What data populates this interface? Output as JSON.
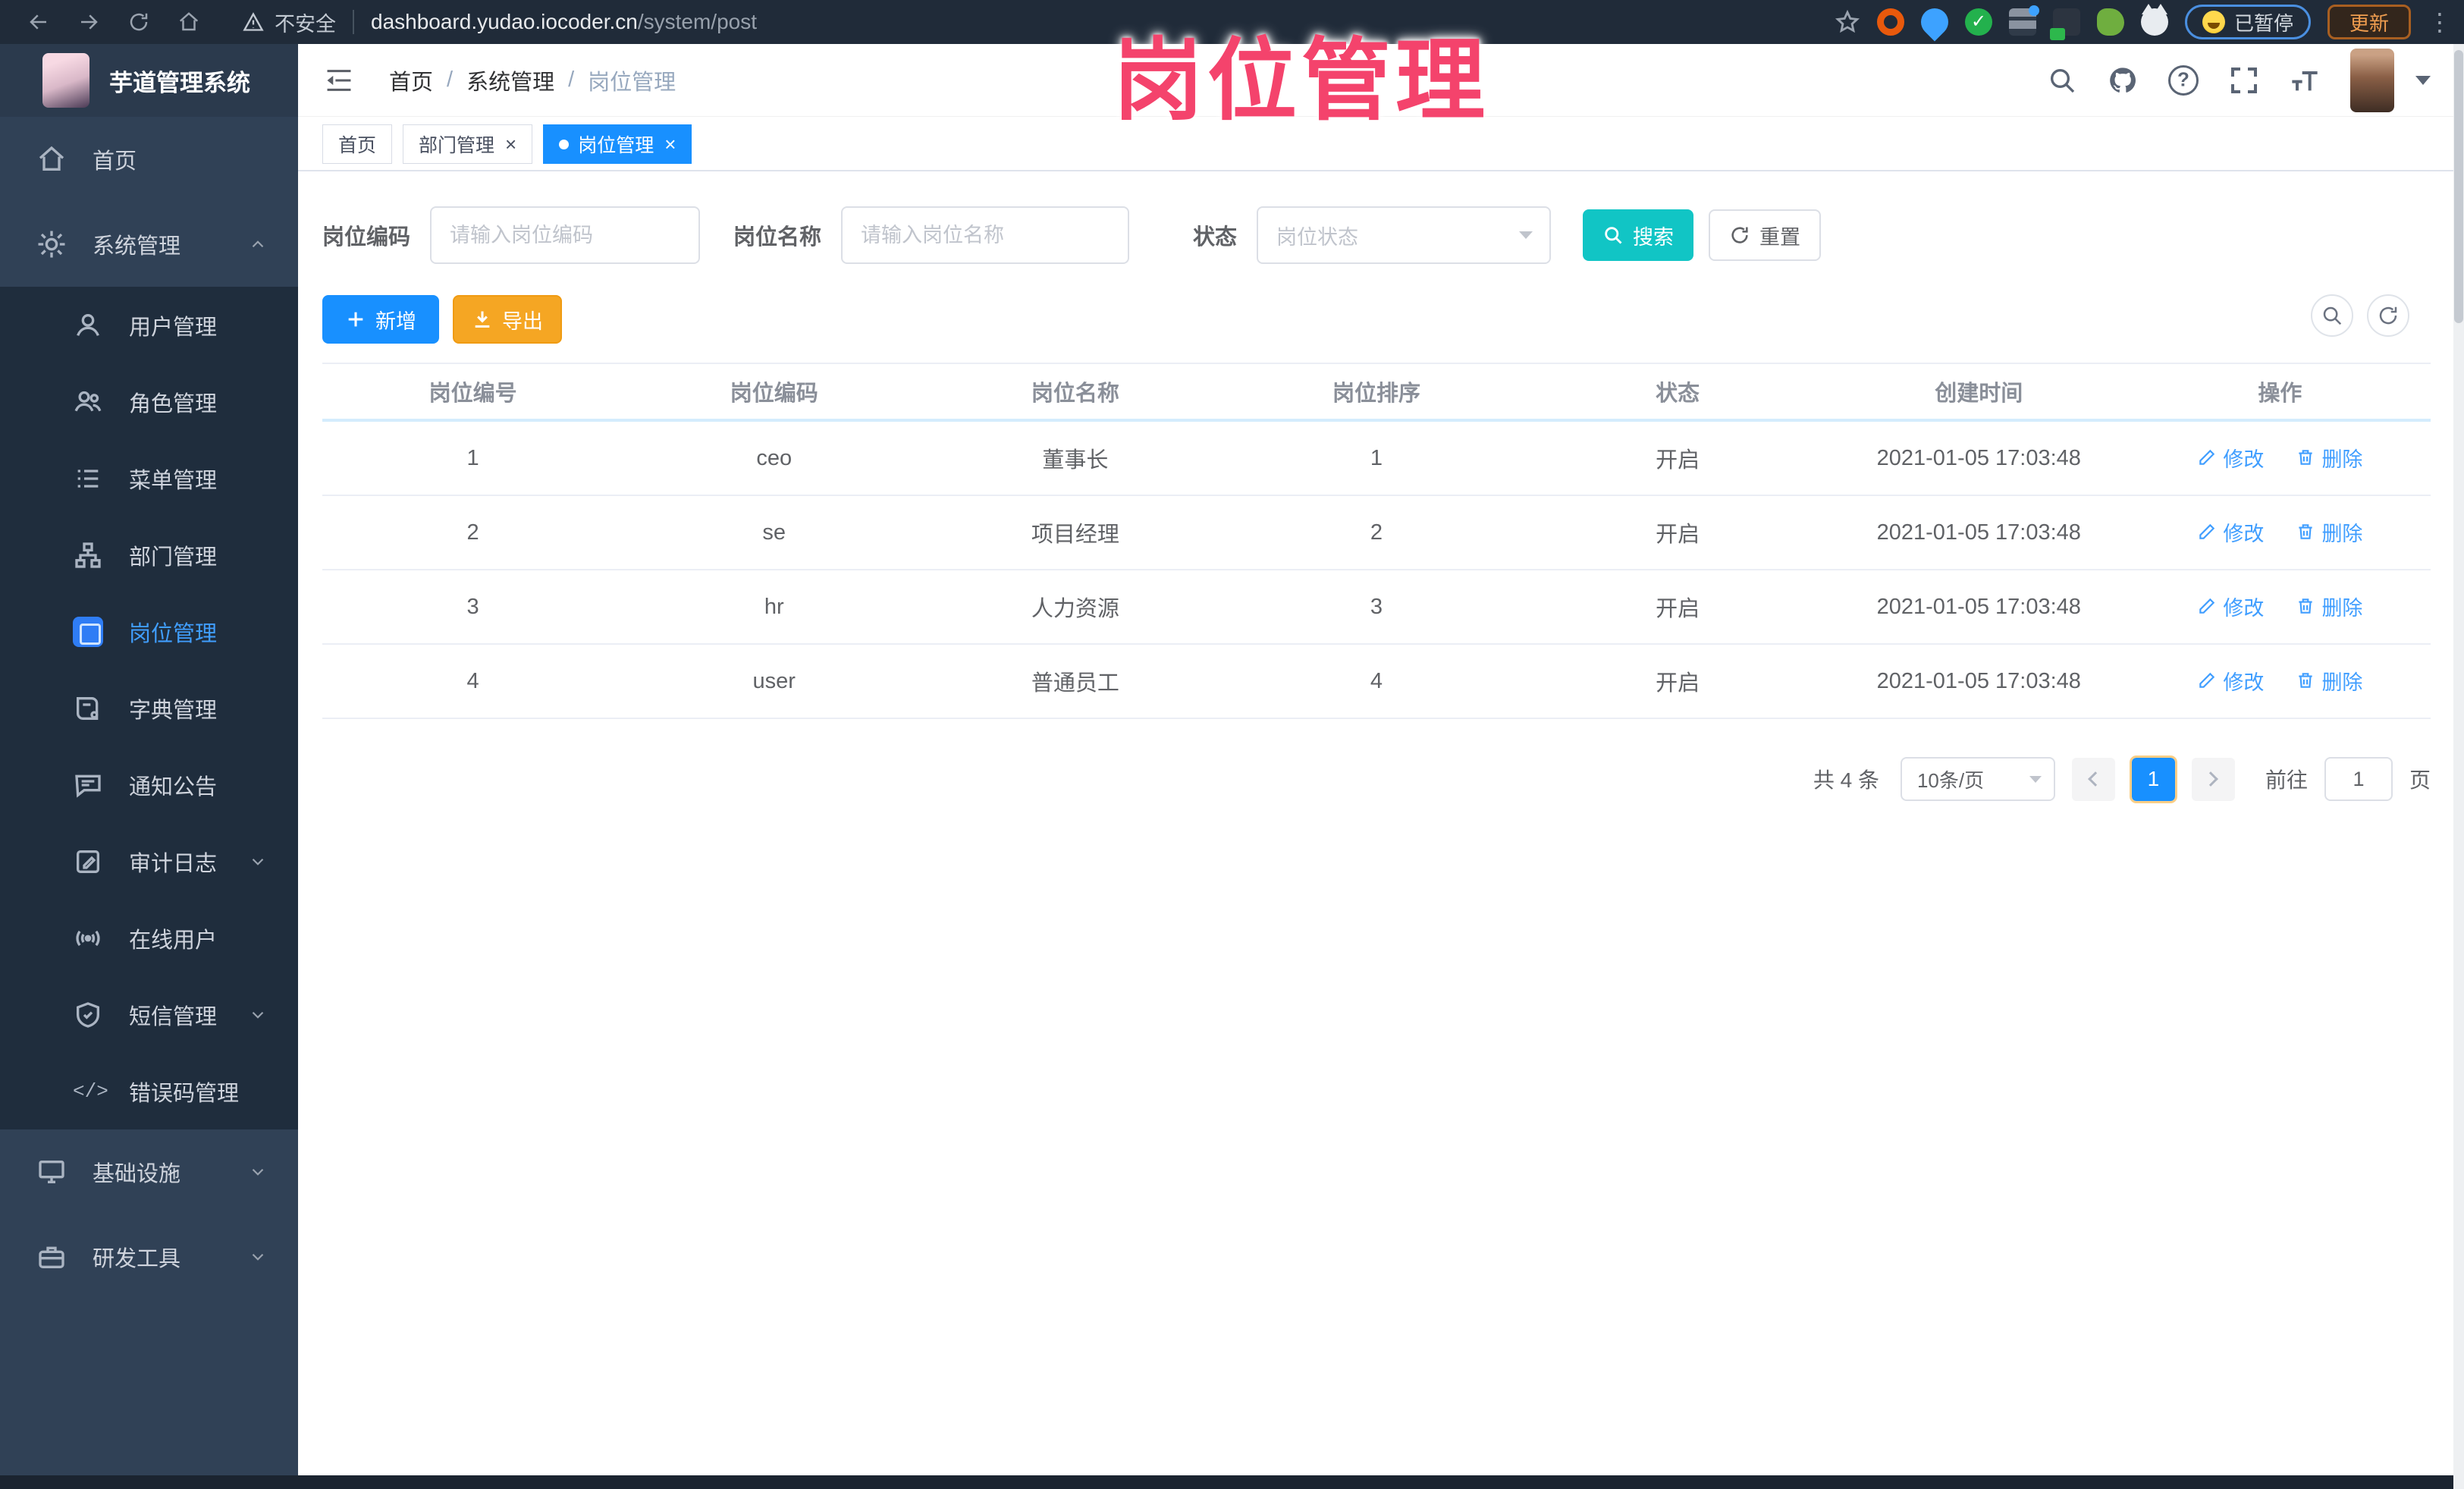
{
  "browser": {
    "security_warning": "不安全",
    "url_host": "dashboard.yudao.iocoder.cn",
    "url_path": "/system/post",
    "paused_badge": "已暂停",
    "update_button": "更新"
  },
  "watermark": {
    "text": "岗位管理"
  },
  "sidebar": {
    "logo_title": "芋道管理系统",
    "items": [
      {
        "label": "首页"
      },
      {
        "label": "系统管理"
      },
      {
        "label": "用户管理"
      },
      {
        "label": "角色管理"
      },
      {
        "label": "菜单管理"
      },
      {
        "label": "部门管理"
      },
      {
        "label": "岗位管理"
      },
      {
        "label": "字典管理"
      },
      {
        "label": "通知公告"
      },
      {
        "label": "审计日志"
      },
      {
        "label": "在线用户"
      },
      {
        "label": "短信管理"
      },
      {
        "label": "错误码管理"
      },
      {
        "label": "基础设施"
      },
      {
        "label": "研发工具"
      }
    ]
  },
  "header": {
    "breadcrumb": [
      "首页",
      "系统管理",
      "岗位管理"
    ]
  },
  "tabs": [
    {
      "label": "首页"
    },
    {
      "label": "部门管理"
    },
    {
      "label": "岗位管理"
    }
  ],
  "filters": {
    "code_label": "岗位编码",
    "code_placeholder": "请输入岗位编码",
    "name_label": "岗位名称",
    "name_placeholder": "请输入岗位名称",
    "status_label": "状态",
    "status_placeholder": "岗位状态",
    "search_label": "搜索",
    "reset_label": "重置"
  },
  "toolbar": {
    "add_label": "新增",
    "export_label": "导出"
  },
  "table": {
    "columns": [
      "岗位编号",
      "岗位编码",
      "岗位名称",
      "岗位排序",
      "状态",
      "创建时间",
      "操作"
    ],
    "edit_label": "修改",
    "delete_label": "删除",
    "rows": [
      {
        "id": "1",
        "code": "ceo",
        "name": "董事长",
        "sort": "1",
        "status": "开启",
        "created": "2021-01-05 17:03:48"
      },
      {
        "id": "2",
        "code": "se",
        "name": "项目经理",
        "sort": "2",
        "status": "开启",
        "created": "2021-01-05 17:03:48"
      },
      {
        "id": "3",
        "code": "hr",
        "name": "人力资源",
        "sort": "3",
        "status": "开启",
        "created": "2021-01-05 17:03:48"
      },
      {
        "id": "4",
        "code": "user",
        "name": "普通员工",
        "sort": "4",
        "status": "开启",
        "created": "2021-01-05 17:03:48"
      }
    ]
  },
  "pagination": {
    "total": "共 4 条",
    "page_size": "10条/页",
    "current_page": "1",
    "goto_label": "前往",
    "goto_value": "1",
    "page_suffix": "页"
  },
  "colors": {
    "accent_blue": "#1890ff",
    "link_blue": "#409eff",
    "search_teal": "#11c5c5",
    "export_orange": "#f5a623",
    "watermark_pink": "#f4436c",
    "sidebar_bg": "#304156",
    "submenu_bg": "#1f2d3d",
    "browser_bg": "#202b39"
  },
  "icons": [
    "back-icon",
    "forward-icon",
    "reload-icon",
    "home-icon",
    "warning-icon",
    "star-icon",
    "search-icon",
    "github-icon",
    "help-icon",
    "fullscreen-icon",
    "font-size-icon",
    "chevron-down-icon",
    "plus-icon",
    "download-icon",
    "magnifier-icon",
    "refresh-icon",
    "edit-icon",
    "trash-icon",
    "close-icon"
  ]
}
